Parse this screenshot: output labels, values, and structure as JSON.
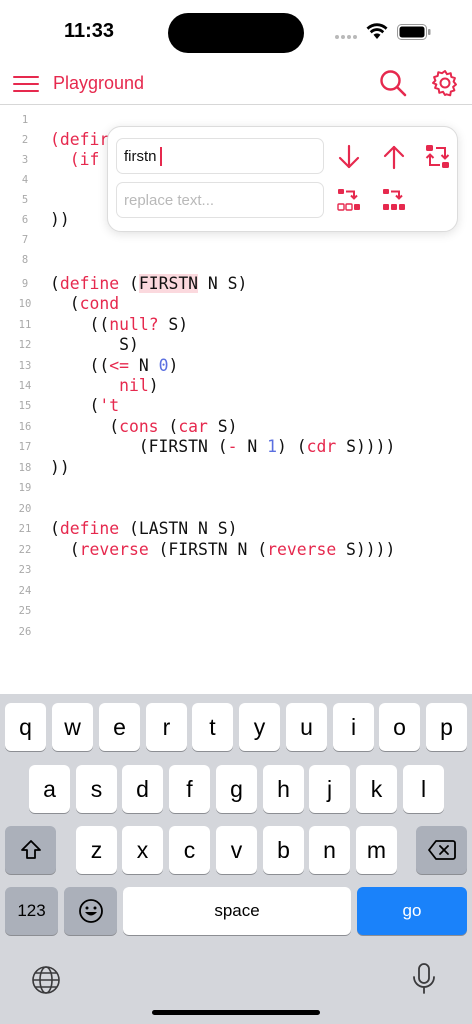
{
  "status": {
    "time": "11:33"
  },
  "nav": {
    "title": "Playground"
  },
  "find": {
    "value": "firstn",
    "replace_placeholder": "replace text..."
  },
  "editor": {
    "line_numbers": [
      "1",
      "2",
      "3",
      "4",
      "5",
      "6",
      "7",
      "8",
      "9",
      "10",
      "11",
      "12",
      "13",
      "14",
      "15",
      "16",
      "17",
      "18",
      "19",
      "20",
      "21",
      "22",
      "23",
      "24",
      "25",
      "26"
    ],
    "l2a": "(defi",
    "l2b": "r",
    "l3a": "  (i",
    "l3b": "f",
    "l6": "))",
    "l9_open": "(",
    "l9_define": "define",
    "l9_sp": " (",
    "l9_firstn": "FIRSTN",
    "l9_rest": " N S)",
    "l10_open": "  (",
    "l10_cond": "cond",
    "l11_open": "    ((",
    "l11_null": "null?",
    "l11_rest": " S)",
    "l12": "       S)",
    "l13_open": "    ((",
    "l13_le": "<=",
    "l13_mid": " N ",
    "l13_zero": "0",
    "l13_close": ")",
    "l14_pad": "       ",
    "l14_nil": "nil",
    "l14_close": ")",
    "l15_pad": "    (",
    "l15_t": "'t",
    "l16_open": "      (",
    "l16_cons": "cons",
    "l16_mid": " (",
    "l16_car": "car",
    "l16_close": " S)",
    "l17_open": "         (FIRSTN (",
    "l17_minus": "-",
    "l17_mid": " N ",
    "l17_one": "1",
    "l17_mid2": ") (",
    "l17_cdr": "cdr",
    "l17_close": " S))))",
    "l18": "))",
    "l21_open": "(",
    "l21_define": "define",
    "l21_rest": " (LASTN N S)",
    "l22_open": "  (",
    "l22_rev1": "reverse",
    "l22_mid": " (FIRSTN N (",
    "l22_rev2": "reverse",
    "l22_close": " S))))"
  },
  "keyboard": {
    "row1": [
      "q",
      "w",
      "e",
      "r",
      "t",
      "y",
      "u",
      "i",
      "o",
      "p"
    ],
    "row2": [
      "a",
      "s",
      "d",
      "f",
      "g",
      "h",
      "j",
      "k",
      "l"
    ],
    "row3": [
      "z",
      "x",
      "c",
      "v",
      "b",
      "n",
      "m"
    ],
    "numbers": "123",
    "space": "space",
    "go": "go"
  },
  "colors": {
    "accent": "#e6294e",
    "number": "#5a6fe0",
    "highlight": "#fbd9de",
    "go_key": "#1a82fa"
  }
}
